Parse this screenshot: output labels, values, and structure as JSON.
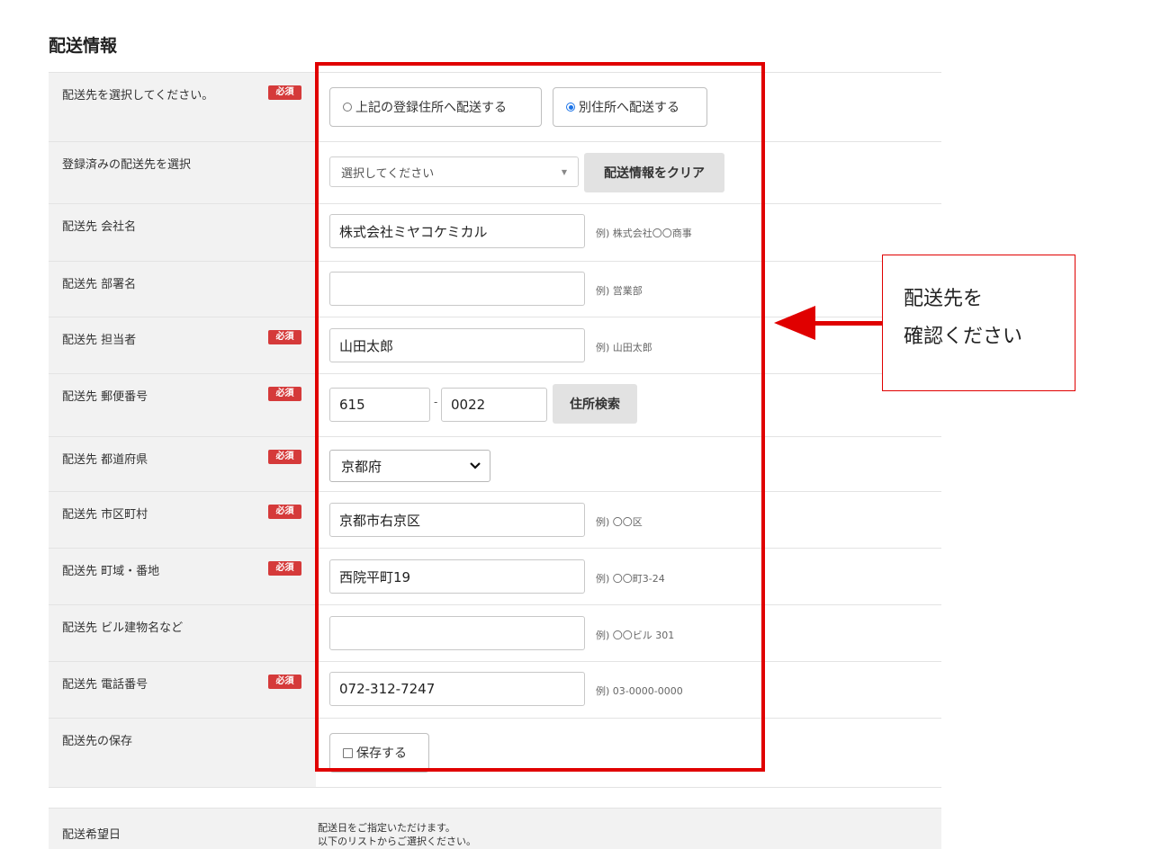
{
  "section_title": "配送情報",
  "required_label": "必須",
  "rows": {
    "select_dest": {
      "label": "配送先を選択してください。",
      "opt1": "上記の登録住所へ配送する",
      "opt2": "別住所へ配送する"
    },
    "registered": {
      "label": "登録済みの配送先を選択",
      "placeholder": "選択してください",
      "clear_button": "配送情報をクリア"
    },
    "company": {
      "label": "配送先 会社名",
      "value": "株式会社ミヤコケミカル",
      "hint": "例) 株式会社〇〇商事"
    },
    "department": {
      "label": "配送先 部署名",
      "value": "",
      "hint": "例) 営業部"
    },
    "person": {
      "label": "配送先 担当者",
      "value": "山田太郎",
      "hint": "例) 山田太郎"
    },
    "postal": {
      "label": "配送先 郵便番号",
      "value1": "615",
      "separator": "-",
      "value2": "0022",
      "search_button": "住所検索"
    },
    "prefecture": {
      "label": "配送先 都道府県",
      "value": "京都府"
    },
    "city": {
      "label": "配送先 市区町村",
      "value": "京都市右京区",
      "hint": "例) 〇〇区"
    },
    "street": {
      "label": "配送先 町域・番地",
      "value": "西院平町19",
      "hint": "例) 〇〇町3-24"
    },
    "building": {
      "label": "配送先 ビル建物名など",
      "value": "",
      "hint": "例) 〇〇ビル 301"
    },
    "phone": {
      "label": "配送先 電話番号",
      "value": "072-312-7247",
      "hint": "例) 03-0000-0000"
    },
    "save": {
      "label": "配送先の保存",
      "checkbox_label": "保存する"
    },
    "delivery_date": {
      "label": "配送希望日",
      "desc1": "配送日をご指定いただけます。",
      "desc2": "以下のリストからご選択ください。"
    }
  },
  "callout": {
    "line1": "配送先を",
    "line2": "確認ください"
  },
  "colors": {
    "highlight": "#e00000",
    "required_badge": "#d53a3a",
    "radio_selected": "#1a73e8",
    "label_bg": "#f2f2f2"
  },
  "icons": {
    "dropdown": "caret-down-icon",
    "chevron": "chevron-down-icon",
    "arrow": "arrow-left-icon"
  }
}
